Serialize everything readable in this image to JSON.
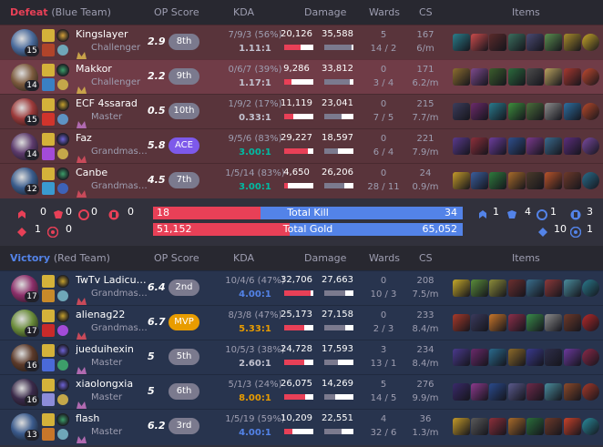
{
  "header_cols": {
    "op_score": "OP Score",
    "kda": "KDA",
    "damage": "Damage",
    "wards": "Wards",
    "cs": "CS",
    "items": "Items"
  },
  "colors": {
    "defeat": "#e84057",
    "victory": "#5383e8",
    "defeat_bg": "#59343b",
    "victory_bg": "#28344e"
  },
  "defeat": {
    "result": "Defeat",
    "team": "(Blue Team)",
    "players": [
      {
        "name": "Kingslayer",
        "level": "15",
        "tier": "Challenger",
        "tier_icon": "challenger",
        "op": "2.9",
        "rank": "8th",
        "kda_line": "7/9/3 (56%)",
        "kda_ratio": "1.11:1",
        "kda_color": "#c3c3d0",
        "dealt": "20,126",
        "taken": "35,588",
        "dealt_pct": 0.56,
        "taken_pct": 0.93,
        "wards": "5",
        "wards_pw": "14 / 2",
        "cs": "167",
        "cspm": "6/m",
        "champ": "#4a6b9c",
        "spells": [
          "#d4b23a",
          "#b0442a"
        ],
        "rune_main": "#d6a13a",
        "rune_sub": "#6fa7b8",
        "items": [
          "#2b7d8a",
          "#c94b4b",
          "#5a2a2a",
          "#3b6e5d",
          "#4a4a72",
          "#5b8e4f",
          "#a88b2c",
          "#c8a72a"
        ],
        "me": false
      },
      {
        "name": "Makkor",
        "level": "14",
        "tier": "Challenger",
        "tier_icon": "challenger",
        "op": "2.2",
        "rank": "9th",
        "kda_line": "0/6/7 (39%)",
        "kda_ratio": "1.17:1",
        "kda_color": "#c3c3d0",
        "dealt": "9,286",
        "taken": "33,812",
        "dealt_pct": 0.26,
        "taken_pct": 0.88,
        "wards": "0",
        "wards_pw": "3 / 4",
        "cs": "171",
        "cspm": "6.2/m",
        "champ": "#7c5a3d",
        "spells": [
          "#d4b23a",
          "#3a80c4"
        ],
        "rune_main": "#3d9e6a",
        "rune_sub": "#c4a84a",
        "items": [
          "#8c6d2f",
          "#7d4a8c",
          "#3b5e2c",
          "#2b6a3c",
          "#4c4c4c",
          "#b8a15e",
          "#a6382f",
          "#c24a2f"
        ],
        "me": true
      },
      {
        "name": "ECF 4ssarad",
        "level": "15",
        "tier": "Master",
        "tier_icon": "master",
        "op": "0.5",
        "rank": "10th",
        "kda_line": "1/9/2 (17%)",
        "kda_ratio": "0.33:1",
        "kda_color": "#c3c3d0",
        "dealt": "11,119",
        "taken": "23,041",
        "dealt_pct": 0.31,
        "taken_pct": 0.6,
        "wards": "0",
        "wards_pw": "7 / 5",
        "cs": "215",
        "cspm": "7.7/m",
        "champ": "#9c3a3a",
        "spells": [
          "#d4b23a",
          "#d0342c"
        ],
        "rune_main": "#c6a12e",
        "rune_sub": "#5e93c4",
        "items": [
          "#3d3d5c",
          "#6c2a6a",
          "#2a7a8c",
          "#3d8e3c",
          "#4a6e3a",
          "#8c8c8c",
          "#2e6fa0",
          "#b94a2a"
        ],
        "me": false
      },
      {
        "name": "Faz",
        "level": "14",
        "tier": "Grandmaster",
        "tier_icon": "grandmaster",
        "op": "5.8",
        "rank": "ACE",
        "kda_line": "9/5/6 (83%)",
        "kda_ratio": "3.00:1",
        "kda_color": "#00bba3",
        "dealt": "29,227",
        "taken": "18,597",
        "dealt_pct": 0.81,
        "taken_pct": 0.48,
        "wards": "0",
        "wards_pw": "6 / 4",
        "cs": "221",
        "cspm": "7.9/m",
        "champ": "#5c3a6c",
        "spells": [
          "#d4b23a",
          "#a34bd8"
        ],
        "rune_main": "#6e62d6",
        "rune_sub": "#c4a84a",
        "items": [
          "#5a3a8c",
          "#8c2f3a",
          "#6c3d9c",
          "#2e4f8c",
          "#7a3a8c",
          "#3a6a8c",
          "#5c2e7c",
          "#7a4aa0"
        ],
        "me": false
      },
      {
        "name": "Canbe",
        "level": "12",
        "tier": "Grandmaster",
        "tier_icon": "grandmaster",
        "op": "4.5",
        "rank": "7th",
        "kda_line": "1/5/14 (83%)",
        "kda_ratio": "3.00:1",
        "kda_color": "#00bba3",
        "dealt": "4,650",
        "taken": "26,206",
        "dealt_pct": 0.13,
        "taken_pct": 0.68,
        "wards": "28 / 11",
        "wards_pw": "28 / 11",
        "cs": "24",
        "cspm": "0.9/m",
        "champ": "#3a5c8c",
        "spells": [
          "#d4b23a",
          "#3a9ad0"
        ],
        "rune_main": "#3d9e6a",
        "rune_sub": "#3d62b8",
        "items": [
          "#c49a2a",
          "#3b5e9c",
          "#2e7a3c",
          "#a86b2a",
          "#4a3a2a",
          "#b8542a",
          "#6e3a2a",
          "#2a6e8c"
        ],
        "me": false
      }
    ]
  },
  "summary": {
    "blue": {
      "obj1": "0",
      "obj2": "0",
      "obj3": "0",
      "obj4": "0",
      "obj5": "1",
      "obj6": "0"
    },
    "red": {
      "obj1": "1",
      "obj2": "4",
      "obj3": "1",
      "obj4": "3",
      "obj5": "10",
      "obj6": "1"
    },
    "total_kill_label": "Total Kill",
    "total_gold_label": "Total Gold",
    "kill_blue": "18",
    "kill_red": "34",
    "kill_blue_frac": 0.346,
    "gold_blue": "51,152",
    "gold_red": "65,052",
    "gold_blue_frac": 0.44
  },
  "victory": {
    "result": "Victory",
    "team": "(Red Team)",
    "players": [
      {
        "name": "TwTv Ladicus Ozari",
        "level": "17",
        "tier": "Grandmaster",
        "tier_icon": "grandmaster",
        "op": "6.4",
        "rank": "2nd",
        "kda_line": "10/4/6 (47%)",
        "kda_ratio": "4.00:1",
        "kda_color": "#5383e8",
        "dealt": "32,706",
        "taken": "27,663",
        "dealt_pct": 0.91,
        "taken_pct": 0.72,
        "wards": "0",
        "wards_pw": "10 / 3",
        "cs": "208",
        "cspm": "7.5/m",
        "champ": "#8c2f6a",
        "spells": [
          "#d4b23a",
          "#c88a2a"
        ],
        "rune_main": "#c6a12e",
        "rune_sub": "#6fa7b8",
        "items": [
          "#c4a82a",
          "#5a8c3a",
          "#8c8c3a",
          "#6c2f2f",
          "#3a6e8c",
          "#8c3a3a",
          "#4a8c9c",
          "#2a7a8c"
        ],
        "me": false
      },
      {
        "name": "alienag22",
        "level": "17",
        "tier": "Grandmaster",
        "tier_icon": "grandmaster",
        "op": "6.7",
        "rank": "MVP",
        "kda_line": "8/3/8 (47%)",
        "kda_ratio": "5.33:1",
        "kda_color": "#e89c00",
        "dealt": "25,173",
        "taken": "27,158",
        "dealt_pct": 0.7,
        "taken_pct": 0.71,
        "wards": "0",
        "wards_pw": "2 / 3",
        "cs": "233",
        "cspm": "8.4/m",
        "champ": "#6a8c3a",
        "spells": [
          "#d4b23a",
          "#c82a2a"
        ],
        "rune_main": "#c6a12e",
        "rune_sub": "#a34bd8",
        "items": [
          "#a83a2a",
          "#3a3a5c",
          "#c8762a",
          "#8c2f4a",
          "#3a8c4a",
          "#8c8c8c",
          "#6e3a2a",
          "#b82a2a"
        ],
        "me": false
      },
      {
        "name": "jueduihexin",
        "level": "16",
        "tier": "Master",
        "tier_icon": "master",
        "op": "5",
        "rank": "5th",
        "kda_line": "10/5/3 (38%)",
        "kda_ratio": "2.60:1",
        "kda_color": "#c3c3d0",
        "dealt": "24,728",
        "taken": "17,593",
        "dealt_pct": 0.69,
        "taken_pct": 0.46,
        "wards": "3",
        "wards_pw": "13 / 1",
        "cs": "234",
        "cspm": "8.4/m",
        "champ": "#5c3a2a",
        "spells": [
          "#d4b23a",
          "#4a6ad8"
        ],
        "rune_main": "#6e62d6",
        "rune_sub": "#3d9e6a",
        "items": [
          "#4a3a8c",
          "#6a2a6a",
          "#2a6a8c",
          "#8c6a2a",
          "#3a3a8c",
          "#2e2e4a",
          "#6c3a9c",
          "#8c2a4a"
        ],
        "me": false
      },
      {
        "name": "xiaolongxia",
        "level": "16",
        "tier": "Master",
        "tier_icon": "master",
        "op": "5",
        "rank": "6th",
        "kda_line": "5/1/3 (24%)",
        "kda_ratio": "8.00:1",
        "kda_color": "#e89c00",
        "dealt": "26,075",
        "taken": "14,269",
        "dealt_pct": 0.73,
        "taken_pct": 0.37,
        "wards": "5",
        "wards_pw": "14 / 5",
        "cs": "276",
        "cspm": "9.9/m",
        "champ": "#3a2a4a",
        "spells": [
          "#d4b23a",
          "#8c8cd8"
        ],
        "rune_main": "#6e62d6",
        "rune_sub": "#c4a84a",
        "items": [
          "#3a2a6a",
          "#8c3a8c",
          "#2a4a8c",
          "#5a5a8c",
          "#6e2a4a",
          "#4a8c9c",
          "#8c4a2a",
          "#a83a2a"
        ],
        "me": false
      },
      {
        "name": "flash",
        "level": "13",
        "tier": "Master",
        "tier_icon": "master",
        "op": "6.2",
        "rank": "3rd",
        "kda_line": "1/5/19 (59%)",
        "kda_ratio": "4.00:1",
        "kda_color": "#5383e8",
        "dealt": "10,209",
        "taken": "22,551",
        "dealt_pct": 0.29,
        "taken_pct": 0.59,
        "wards": "4",
        "wards_pw": "32 / 6",
        "cs": "36",
        "cspm": "1.3/m",
        "champ": "#3a5a8c",
        "spells": [
          "#d4b23a",
          "#c8762a"
        ],
        "rune_main": "#3d9e6a",
        "rune_sub": "#6fa7b8",
        "items": [
          "#c49a2a",
          "#5a5a5a",
          "#8c2f3a",
          "#a86b2a",
          "#2a6e3a",
          "#6e3a2a",
          "#c8422a",
          "#2a8c9c"
        ],
        "me": false
      }
    ]
  }
}
